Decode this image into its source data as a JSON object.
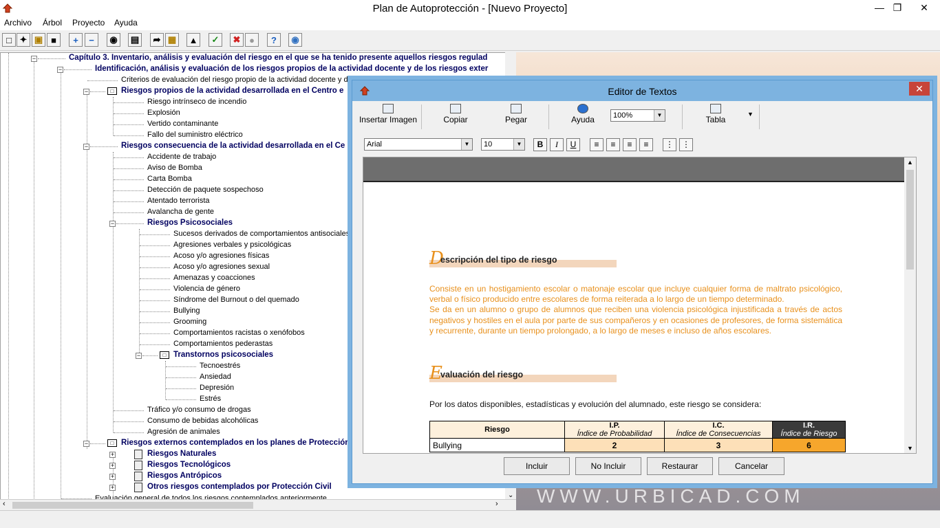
{
  "window": {
    "title": "Plan de Autoprotección - [Nuevo Proyecto]",
    "min_icon": "minimize-icon",
    "max_icon": "maximize-icon",
    "close_icon": "close-icon"
  },
  "menu": [
    "Archivo",
    "Árbol",
    "Proyecto",
    "Ayuda"
  ],
  "toolbar_icons": [
    "new-document-icon",
    "wizard-icon",
    "open-folder-icon",
    "save-icon",
    "expand-all-icon",
    "collapse-all-icon",
    "binoculars-icon",
    "print-preview-icon",
    "export-icon",
    "note-icon",
    "tree-structure-icon",
    "check-icon",
    "stop-icon",
    "disabled-icon",
    "help-icon",
    "info-icon"
  ],
  "tree": {
    "items": [
      {
        "label": "Capítulo 3. Inventario, análisis y evaluación del riesgo en el que se ha tenido presente aquellos riesgos regulad",
        "bold": true
      },
      {
        "label": "Identificación, análisis y evaluación de los riesgos propios de la actividad docente y de los riesgos exter",
        "bold": true
      },
      {
        "label": "Criterios de evaluación del riesgo propio de la actividad docente y de los riesgos externos que pueden afectarle",
        "bold": false
      },
      {
        "label": "Riesgos propios de la actividad desarrollada en el Centro e",
        "bold": true
      },
      {
        "label": "Riesgo intrínseco de incendio",
        "bold": false
      },
      {
        "label": "Explosión",
        "bold": false
      },
      {
        "label": "Vertido contaminante",
        "bold": false
      },
      {
        "label": "Fallo del suministro eléctrico",
        "bold": false
      },
      {
        "label": "Riesgos consecuencia de la actividad desarrollada en el Ce",
        "bold": true
      },
      {
        "label": "Accidente de trabajo",
        "bold": false
      },
      {
        "label": "Aviso de Bomba",
        "bold": false
      },
      {
        "label": "Carta Bomba",
        "bold": false
      },
      {
        "label": "Detección de paquete sospechoso",
        "bold": false
      },
      {
        "label": "Atentado terrorista",
        "bold": false
      },
      {
        "label": "Avalancha de gente",
        "bold": false
      },
      {
        "label": "Riesgos Psicosociales",
        "bold": true
      },
      {
        "label": "Sucesos derivados de comportamientos antisociales en",
        "bold": false
      },
      {
        "label": "Agresiones verbales y psicológicas",
        "bold": false
      },
      {
        "label": "Acoso y/o agresiones físicas",
        "bold": false
      },
      {
        "label": "Acoso y/o agresiones sexual",
        "bold": false
      },
      {
        "label": "Amenazas y coacciones",
        "bold": false
      },
      {
        "label": "Violencia de género",
        "bold": false
      },
      {
        "label": "Síndrome del Burnout o del quemado",
        "bold": false
      },
      {
        "label": "Bullying",
        "bold": false
      },
      {
        "label": "Grooming",
        "bold": false
      },
      {
        "label": "Comportamientos racistas o xenófobos",
        "bold": false
      },
      {
        "label": "Comportamientos pederastas",
        "bold": false
      },
      {
        "label": "Transtornos psicosociales",
        "bold": true
      },
      {
        "label": "Tecnoestrés",
        "bold": false
      },
      {
        "label": "Ansiedad",
        "bold": false
      },
      {
        "label": "Depresión",
        "bold": false
      },
      {
        "label": "Estrés",
        "bold": false
      },
      {
        "label": "Tráfico y/o consumo de drogas",
        "bold": false
      },
      {
        "label": "Consumo de bebidas alcohólicas",
        "bold": false
      },
      {
        "label": "Agresión de animales",
        "bold": false
      },
      {
        "label": "Riesgos externos contemplados en los planes de Protección",
        "bold": true
      },
      {
        "label": "Riesgos Naturales",
        "bold": true
      },
      {
        "label": "Riesgos Tecnológicos",
        "bold": true
      },
      {
        "label": "Riesgos Antrópicos",
        "bold": true
      },
      {
        "label": "Otros riesgos contemplados por Protección Civil",
        "bold": true
      },
      {
        "label": "Evaluación general de todos los riesgos contemplados anteriormente",
        "bold": false
      }
    ]
  },
  "background_watermark": "WWW.URBICAD.COM",
  "editor": {
    "title": "Editor de Textos",
    "toolbar": {
      "insert_image": "Insertar Imagen",
      "copy": "Copiar",
      "paste": "Pegar",
      "help": "Ayuda",
      "zoom": "100%",
      "table": "Tabla"
    },
    "format": {
      "font": "Arial",
      "size": "10",
      "bold": "B",
      "italic": "I",
      "underline": "U"
    },
    "doc": {
      "sec1_cap": "D",
      "sec1_title": "escripción del tipo de riesgo",
      "paragraph1": "Consiste en un hostigamiento escolar o matonaje escolar que incluye cualquier forma de maltrato psicológico, verbal o físico producido entre escolares de forma reiterada a lo largo de un tiempo determinado.",
      "paragraph2": "Se da en un alumno o grupo de alumnos que reciben una violencia psicológica injustificada a través de actos negativos y hostiles en el aula por parte de sus compañeros y en ocasiones de profesores, de forma sistemática y recurrente, durante un tiempo prolongado, a lo largo de meses e incluso de años escolares.",
      "sec2_cap": "E",
      "sec2_title": "valuación del riesgo",
      "consider": "Por los datos disponibles, estadísticas y evolución del alumnado, este riesgo se considera:",
      "table": {
        "h_riesgo": "Riesgo",
        "h_ip": "I.P.",
        "h_ip_sub": "Índice de Probabilidad",
        "h_ic": "I.C.",
        "h_ic_sub": "Índice de Consecuencias",
        "h_ir": "I.R.",
        "h_ir_sub": "Índice de Riesgo",
        "row_riesgo": "Bullying",
        "row_ip": "2",
        "row_ic": "3",
        "row_ir": "6"
      }
    },
    "buttons": {
      "include": "Incluir",
      "not_include": "No Incluir",
      "restore": "Restaurar",
      "cancel": "Cancelar"
    }
  }
}
